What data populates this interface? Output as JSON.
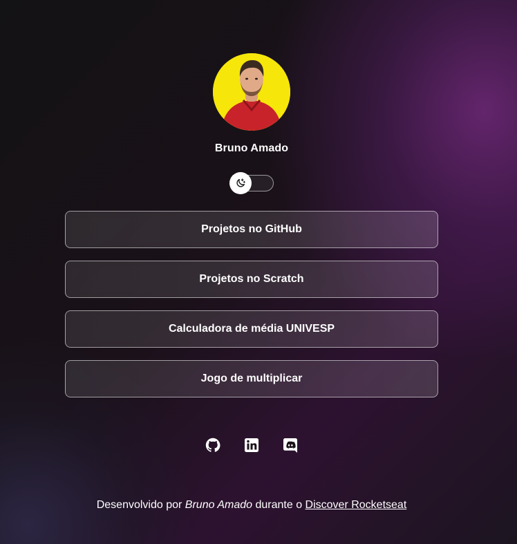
{
  "profile": {
    "name": "Bruno Amado",
    "avatar_background": "#f6e60a"
  },
  "theme_switch": {
    "icon": "moon-icon",
    "state": "dark"
  },
  "links": [
    {
      "label": "Projetos no GitHub"
    },
    {
      "label": "Projetos no Scratch"
    },
    {
      "label": "Calculadora de média UNIVESP"
    },
    {
      "label": "Jogo de multiplicar"
    }
  ],
  "social": [
    {
      "icon": "github-icon"
    },
    {
      "icon": "linkedin-icon"
    },
    {
      "icon": "discord-icon"
    }
  ],
  "footer": {
    "prefix": "Desenvolvido por ",
    "author": "Bruno Amado",
    "middle": " durante o ",
    "link_text": "Discover Rocketseat"
  },
  "colors": {
    "text": "#ffffff",
    "background_dark": "#131214",
    "accent_purple": "#6e2878"
  }
}
